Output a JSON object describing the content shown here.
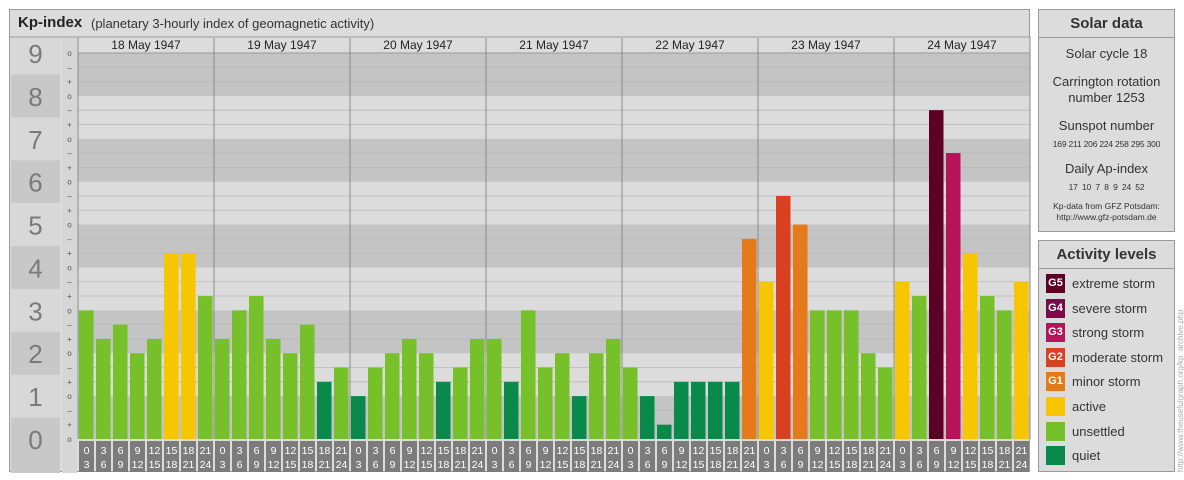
{
  "header": {
    "title": "Kp-index",
    "subtitle": "(planetary 3-hourly index of geomagnetic activity)"
  },
  "chart_data": {
    "type": "bar",
    "ylim": [
      0,
      9
    ],
    "y_ticks": [
      "0",
      "1",
      "2",
      "3",
      "4",
      "5",
      "6",
      "7",
      "8",
      "9"
    ],
    "minor_ticks": [
      "+",
      "o",
      "–"
    ],
    "days": [
      "18 May 1947",
      "19 May 1947",
      "20 May 1947",
      "21 May 1947",
      "22 May 1947",
      "23 May 1947",
      "24 May 1947"
    ],
    "interval_top": [
      "0",
      "3",
      "6",
      "9",
      "12",
      "15",
      "18",
      "21"
    ],
    "interval_bottom": [
      "3",
      "6",
      "9",
      "12",
      "15",
      "18",
      "21",
      "24"
    ],
    "values": [
      [
        3.0,
        2.333,
        2.667,
        2.0,
        2.333,
        4.333,
        4.333,
        3.333
      ],
      [
        2.333,
        3.0,
        3.333,
        2.333,
        2.0,
        2.667,
        1.333,
        1.667
      ],
      [
        1.0,
        1.667,
        2.0,
        2.333,
        2.0,
        1.333,
        1.667,
        2.333
      ],
      [
        2.333,
        1.333,
        3.0,
        1.667,
        2.0,
        1.0,
        2.0,
        2.333
      ],
      [
        1.667,
        1.0,
        0.333,
        1.333,
        1.333,
        1.333,
        1.333,
        4.667
      ],
      [
        3.667,
        5.667,
        5.0,
        3.0,
        3.0,
        3.0,
        2.0,
        1.667
      ],
      [
        3.667,
        3.333,
        7.667,
        6.667,
        4.333,
        3.333,
        3.0,
        3.667
      ]
    ],
    "colors": {
      "g5": "#5c0026",
      "g4": "#7a0a4a",
      "g3": "#b5145b",
      "g2": "#d9401f",
      "g1": "#e57a1a",
      "active": "#f7c600",
      "unsettled": "#76c12a",
      "quiet": "#0a8a4a",
      "band_dark": "#c4c4c4",
      "band_light": "#dcdcdc",
      "axis_cell": "#7c7c7c"
    }
  },
  "solar": {
    "title": "Solar data",
    "cycle": "Solar cycle 18",
    "carrington_line1": "Carrington rotation",
    "carrington_line2": "number 1253",
    "sunspot_label": "Sunspot number",
    "sunspot_values": "169 211 206 224 258 295 300",
    "ap_label": "Daily Ap-index",
    "ap_values": "17  10  7  8  9  24  52",
    "source_line1": "Kp-data from GFZ Potsdam:",
    "source_line2": "http://www.gfz-potsdam.de"
  },
  "legend": {
    "title": "Activity levels",
    "items": [
      {
        "badge": "G5",
        "label": "extreme storm",
        "color": "#5c0026"
      },
      {
        "badge": "G4",
        "label": "severe storm",
        "color": "#7a0a4a"
      },
      {
        "badge": "G3",
        "label": "strong storm",
        "color": "#b5145b"
      },
      {
        "badge": "G2",
        "label": "moderate storm",
        "color": "#d9401f"
      },
      {
        "badge": "G1",
        "label": "minor storm",
        "color": "#e57a1a"
      },
      {
        "badge": "",
        "label": "active",
        "color": "#f7c600"
      },
      {
        "badge": "",
        "label": "unsettled",
        "color": "#76c12a"
      },
      {
        "badge": "",
        "label": "quiet",
        "color": "#0a8a4a"
      }
    ]
  },
  "watermark": "http://www.theusefulgraph.org/kp_archive.php"
}
